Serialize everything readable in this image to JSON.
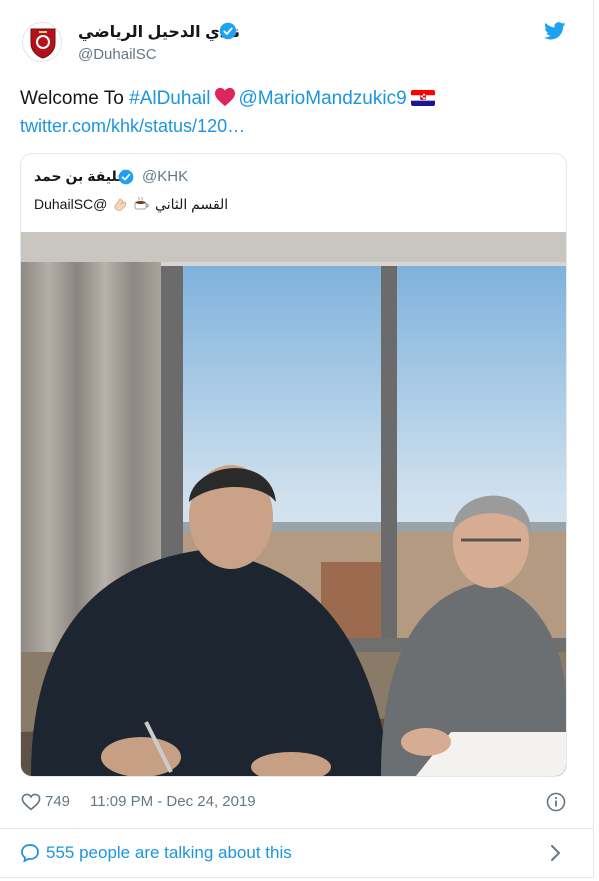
{
  "account": {
    "display_name": "نادي الدحيل الرياضي",
    "handle": "@DuhailSC"
  },
  "tweet": {
    "prefix": "Welcome To ",
    "hashtag": "#AlDuhail",
    "mention": "@MarioMandzukic9",
    "url": "twitter.com/khk/status/120…"
  },
  "quoted": {
    "display_name": "خليفة بن حمد",
    "handle": "@KHK",
    "text_ar": "القسم الثاني",
    "text_tail": "DuhailSC@"
  },
  "footer": {
    "likes": "749",
    "timestamp": "11:09 PM - Dec 24, 2019",
    "talking": "555 people are talking about this"
  },
  "colors": {
    "link": "#1b95e0",
    "verified": "#1da1f2",
    "heart": "#e0245e",
    "club_red": "#b3121b"
  },
  "icons": [
    "club-logo-icon",
    "verified-icon",
    "twitter-bird-icon",
    "heart-icon",
    "croatia-flag-icon",
    "coffee-icon",
    "clap-icon",
    "heart-outline-icon",
    "info-icon",
    "comment-icon",
    "chevron-right-icon"
  ]
}
